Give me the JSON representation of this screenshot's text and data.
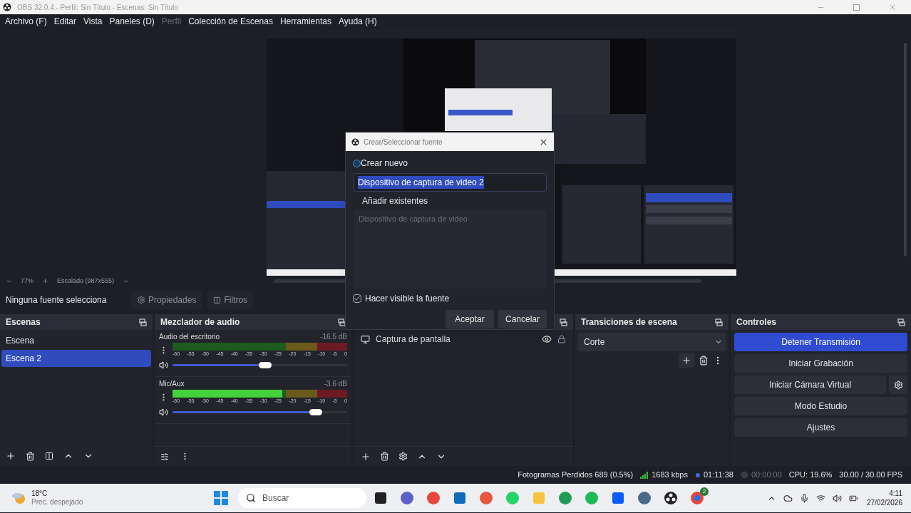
{
  "window": {
    "title": "OBS 32.0.4 - Perfil: Sin Título - Escenas: Sin Título"
  },
  "menu": [
    {
      "label": "Archivo (F)",
      "disabled": false
    },
    {
      "label": "Editar",
      "disabled": false
    },
    {
      "label": "Vista",
      "disabled": false
    },
    {
      "label": "Paneles (D)",
      "disabled": false
    },
    {
      "label": "Perfil",
      "disabled": true
    },
    {
      "label": "Colección de Escenas",
      "disabled": false
    },
    {
      "label": "Herramientas",
      "disabled": false
    },
    {
      "label": "Ayuda (H)",
      "disabled": false
    }
  ],
  "preview": {
    "zoom": "77%",
    "scaling": "Escalado (987x555)"
  },
  "source_toolbar": {
    "status": "Ninguna fuente selecciona",
    "buttons": [
      {
        "kind": "properties",
        "label": "Propiedades"
      },
      {
        "kind": "filters",
        "label": "Filtros"
      }
    ]
  },
  "scenes": {
    "title": "Escenas",
    "items": [
      {
        "label": "Escena",
        "selected": false
      },
      {
        "label": "Escena 2",
        "selected": true
      }
    ]
  },
  "mixer": {
    "title": "Mezclador de audio",
    "channels": [
      {
        "name": "Audio del escritorio",
        "reading": "-16.5 dB",
        "meter": {
          "level": 0
        },
        "scale": [
          "-60",
          "-55",
          "-50",
          "-45",
          "-40",
          "-35",
          "-30",
          "-25",
          "-20",
          "-15",
          "-10",
          "-5",
          "0"
        ],
        "volume": {
          "level": 0.53
        }
      },
      {
        "name": "Mic/Aux",
        "reading": "-3.6 dB",
        "meter": {
          "level": 0.63
        },
        "scale": [
          "-60",
          "-55",
          "-50",
          "-45",
          "-40",
          "-35",
          "-30",
          "-25",
          "-20",
          "-15",
          "-10",
          "-5",
          "0"
        ],
        "volume": {
          "level": 0.82
        }
      }
    ]
  },
  "sources": {
    "items": [
      {
        "label": "Captura de pantalla"
      }
    ]
  },
  "transitions": {
    "title": "Transiciones de escena",
    "current": "Corte"
  },
  "controls": {
    "title": "Controles",
    "buttons": [
      {
        "label": "Detener Transmisión",
        "active": true,
        "has_settings": false
      },
      {
        "label": "Iniciar Grabación",
        "active": false,
        "has_settings": false
      },
      {
        "label": "Iniciar Cámara Virtual",
        "active": false,
        "has_settings": true
      },
      {
        "label": "Modo Estudio",
        "active": false,
        "has_settings": false
      },
      {
        "label": "Ajustes",
        "active": false,
        "has_settings": false
      }
    ]
  },
  "status_bar": {
    "dropped_frames": "Fotogramas Perdidos 689 (0.5%)",
    "bitrate": "1683 kbps",
    "stream_time": "01:11:38",
    "record_time": "00:00:00",
    "cpu": "CPU: 19.6%",
    "fps": "30.00 / 30.00 FPS"
  },
  "dialog": {
    "title": "Crear/Seleccionar fuente",
    "options": [
      {
        "label": "Crear nuevo",
        "selected": true
      },
      {
        "label": "Añadir existentes",
        "selected": false
      }
    ],
    "name_value": "Dispositivo de captura de video 2",
    "existing": [
      {
        "label": "Dispositivo de captura de video",
        "disabled": true
      }
    ],
    "visible_checkbox": {
      "label": "Hacer visible la fuente",
      "checked": true
    },
    "buttons": [
      "Aceptar",
      "Cancelar"
    ]
  },
  "taskbar": {
    "temperature": "18°C",
    "weather": "Prec. despejado",
    "search_placeholder": "Buscar",
    "badge": "2",
    "time": "4:11",
    "date": "27/02/2026"
  }
}
